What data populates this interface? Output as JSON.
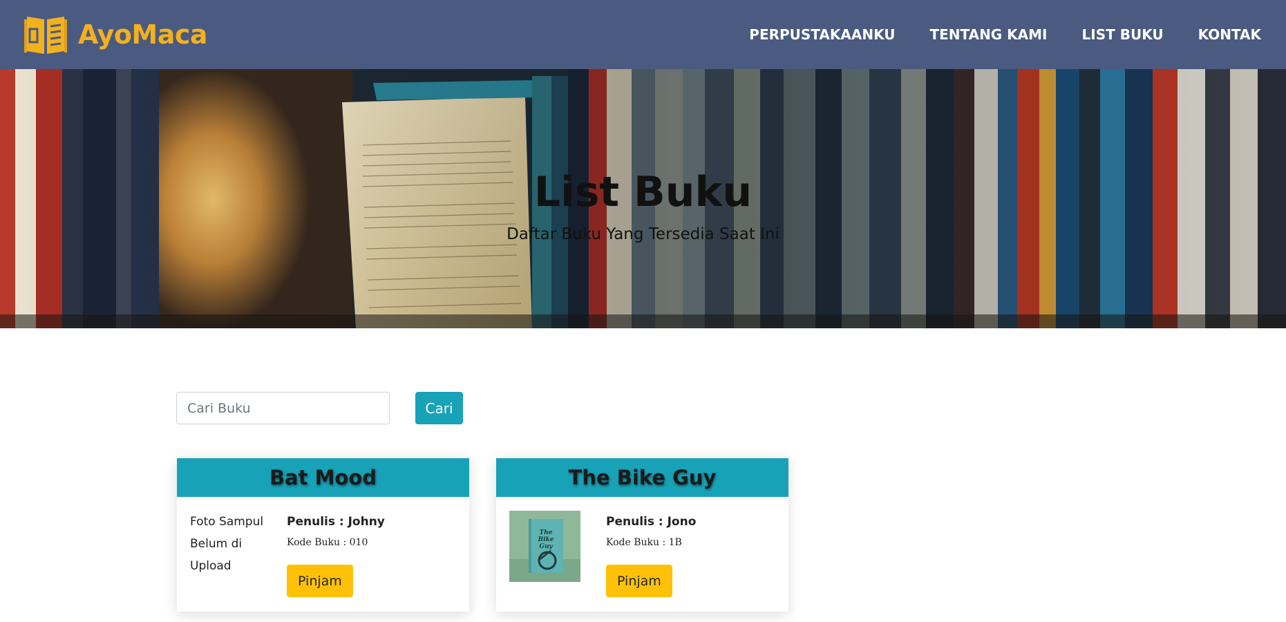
{
  "brand": {
    "name": "AyoMaca",
    "icon": "open-book-icon",
    "color": "#f2b11f"
  },
  "nav": {
    "items": [
      {
        "label": "PERPUSTAKAANKU"
      },
      {
        "label": "TENTANG KAMI"
      },
      {
        "label": "LIST BUKU"
      },
      {
        "label": "KONTAK"
      }
    ],
    "background": "#4a5a80"
  },
  "hero": {
    "title": "List Buku",
    "subtitle": "Daftar Buku Yang Tersedia Saat Ini"
  },
  "search": {
    "placeholder": "Cari Buku",
    "value": "",
    "button_label": "Cari"
  },
  "books": [
    {
      "title": "Bat Mood",
      "cover_text": "Foto Sampul Belum di Upload",
      "author_line": "Penulis : Johny",
      "code_line": "Kode Buku : 010",
      "borrow_label": "Pinjam"
    },
    {
      "title": "The Bike Guy",
      "cover_icon": "book-cover-thumbnail",
      "author_line": "Penulis : Jono",
      "code_line": "Kode Buku : 1B",
      "borrow_label": "Pinjam"
    }
  ],
  "colors": {
    "accent": "#17a2b8",
    "borrow_button": "#ffc107"
  }
}
